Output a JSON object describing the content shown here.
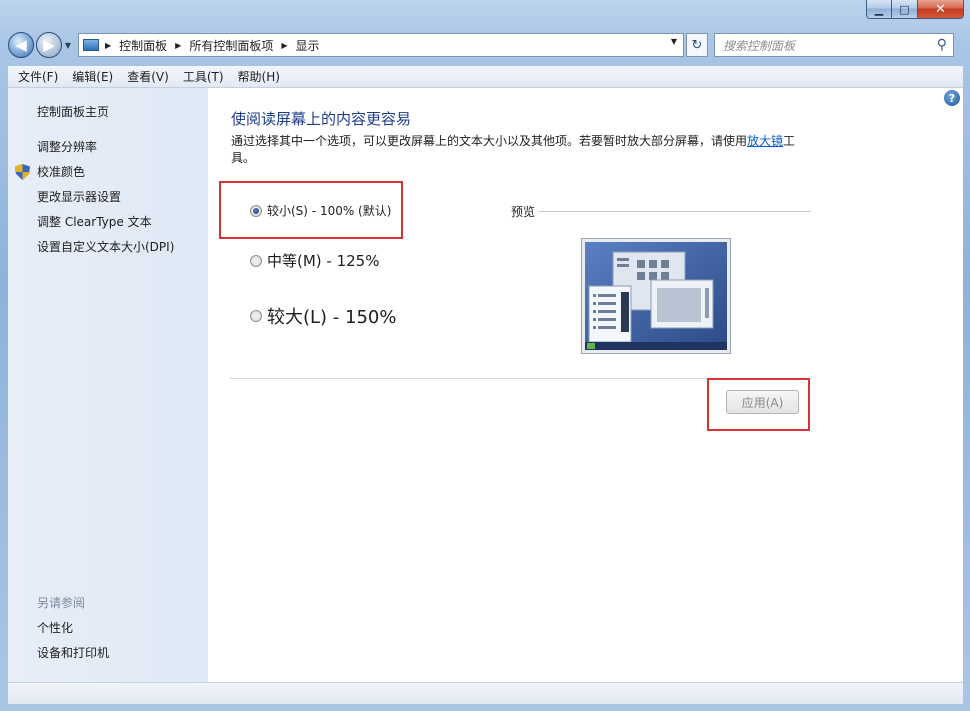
{
  "window": {
    "minimize_glyph": "▁",
    "maximize_glyph": "□",
    "close_glyph": "✕"
  },
  "nav": {
    "back_glyph": "◀",
    "forward_glyph": "▶",
    "breadcrumbs": [
      "控制面板",
      "所有控制面板项",
      "显示"
    ],
    "search_placeholder": "搜索控制面板"
  },
  "menu": [
    "文件(F)",
    "编辑(E)",
    "查看(V)",
    "工具(T)",
    "帮助(H)"
  ],
  "sidebar": {
    "home": "控制面板主页",
    "links": [
      "调整分辨率",
      "校准颜色",
      "更改显示器设置",
      "调整 ClearType 文本",
      "设置自定义文本大小(DPI)"
    ],
    "see_also_heading": "另请参阅",
    "see_also": [
      "个性化",
      "设备和打印机"
    ]
  },
  "main": {
    "title": "使阅读屏幕上的内容更容易",
    "desc_before": "通过选择其中一个选项，可以更改屏幕上的文本大小以及其他项。若要暂时放大部分屏幕，请使用",
    "desc_link": "放大镜",
    "desc_after": "工具。",
    "options": [
      {
        "label": "较小(S) - 100% (默认)",
        "selected": true
      },
      {
        "label": "中等(M) - 125%",
        "selected": false
      },
      {
        "label": "较大(L) - 150%",
        "selected": false
      }
    ],
    "preview_label": "预览",
    "apply_label": "应用(A)",
    "help_glyph": "?"
  },
  "colors": {
    "highlight": "#d63333",
    "title_blue": "#1e3e8c",
    "link_blue": "#0b5bc7"
  }
}
